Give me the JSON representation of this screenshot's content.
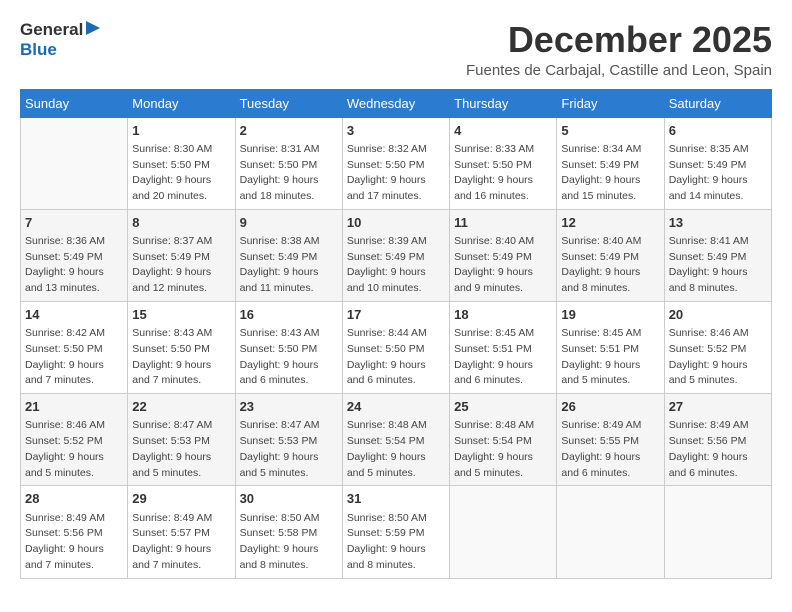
{
  "header": {
    "logo_general": "General",
    "logo_blue": "Blue",
    "month": "December 2025",
    "location": "Fuentes de Carbajal, Castille and Leon, Spain"
  },
  "columns": [
    "Sunday",
    "Monday",
    "Tuesday",
    "Wednesday",
    "Thursday",
    "Friday",
    "Saturday"
  ],
  "weeks": [
    [
      {
        "day": "",
        "info": ""
      },
      {
        "day": "1",
        "info": "Sunrise: 8:30 AM\nSunset: 5:50 PM\nDaylight: 9 hours\nand 20 minutes."
      },
      {
        "day": "2",
        "info": "Sunrise: 8:31 AM\nSunset: 5:50 PM\nDaylight: 9 hours\nand 18 minutes."
      },
      {
        "day": "3",
        "info": "Sunrise: 8:32 AM\nSunset: 5:50 PM\nDaylight: 9 hours\nand 17 minutes."
      },
      {
        "day": "4",
        "info": "Sunrise: 8:33 AM\nSunset: 5:50 PM\nDaylight: 9 hours\nand 16 minutes."
      },
      {
        "day": "5",
        "info": "Sunrise: 8:34 AM\nSunset: 5:49 PM\nDaylight: 9 hours\nand 15 minutes."
      },
      {
        "day": "6",
        "info": "Sunrise: 8:35 AM\nSunset: 5:49 PM\nDaylight: 9 hours\nand 14 minutes."
      }
    ],
    [
      {
        "day": "7",
        "info": "Sunrise: 8:36 AM\nSunset: 5:49 PM\nDaylight: 9 hours\nand 13 minutes."
      },
      {
        "day": "8",
        "info": "Sunrise: 8:37 AM\nSunset: 5:49 PM\nDaylight: 9 hours\nand 12 minutes."
      },
      {
        "day": "9",
        "info": "Sunrise: 8:38 AM\nSunset: 5:49 PM\nDaylight: 9 hours\nand 11 minutes."
      },
      {
        "day": "10",
        "info": "Sunrise: 8:39 AM\nSunset: 5:49 PM\nDaylight: 9 hours\nand 10 minutes."
      },
      {
        "day": "11",
        "info": "Sunrise: 8:40 AM\nSunset: 5:49 PM\nDaylight: 9 hours\nand 9 minutes."
      },
      {
        "day": "12",
        "info": "Sunrise: 8:40 AM\nSunset: 5:49 PM\nDaylight: 9 hours\nand 8 minutes."
      },
      {
        "day": "13",
        "info": "Sunrise: 8:41 AM\nSunset: 5:49 PM\nDaylight: 9 hours\nand 8 minutes."
      }
    ],
    [
      {
        "day": "14",
        "info": "Sunrise: 8:42 AM\nSunset: 5:50 PM\nDaylight: 9 hours\nand 7 minutes."
      },
      {
        "day": "15",
        "info": "Sunrise: 8:43 AM\nSunset: 5:50 PM\nDaylight: 9 hours\nand 7 minutes."
      },
      {
        "day": "16",
        "info": "Sunrise: 8:43 AM\nSunset: 5:50 PM\nDaylight: 9 hours\nand 6 minutes."
      },
      {
        "day": "17",
        "info": "Sunrise: 8:44 AM\nSunset: 5:50 PM\nDaylight: 9 hours\nand 6 minutes."
      },
      {
        "day": "18",
        "info": "Sunrise: 8:45 AM\nSunset: 5:51 PM\nDaylight: 9 hours\nand 6 minutes."
      },
      {
        "day": "19",
        "info": "Sunrise: 8:45 AM\nSunset: 5:51 PM\nDaylight: 9 hours\nand 5 minutes."
      },
      {
        "day": "20",
        "info": "Sunrise: 8:46 AM\nSunset: 5:52 PM\nDaylight: 9 hours\nand 5 minutes."
      }
    ],
    [
      {
        "day": "21",
        "info": "Sunrise: 8:46 AM\nSunset: 5:52 PM\nDaylight: 9 hours\nand 5 minutes."
      },
      {
        "day": "22",
        "info": "Sunrise: 8:47 AM\nSunset: 5:53 PM\nDaylight: 9 hours\nand 5 minutes."
      },
      {
        "day": "23",
        "info": "Sunrise: 8:47 AM\nSunset: 5:53 PM\nDaylight: 9 hours\nand 5 minutes."
      },
      {
        "day": "24",
        "info": "Sunrise: 8:48 AM\nSunset: 5:54 PM\nDaylight: 9 hours\nand 5 minutes."
      },
      {
        "day": "25",
        "info": "Sunrise: 8:48 AM\nSunset: 5:54 PM\nDaylight: 9 hours\nand 5 minutes."
      },
      {
        "day": "26",
        "info": "Sunrise: 8:49 AM\nSunset: 5:55 PM\nDaylight: 9 hours\nand 6 minutes."
      },
      {
        "day": "27",
        "info": "Sunrise: 8:49 AM\nSunset: 5:56 PM\nDaylight: 9 hours\nand 6 minutes."
      }
    ],
    [
      {
        "day": "28",
        "info": "Sunrise: 8:49 AM\nSunset: 5:56 PM\nDaylight: 9 hours\nand 7 minutes."
      },
      {
        "day": "29",
        "info": "Sunrise: 8:49 AM\nSunset: 5:57 PM\nDaylight: 9 hours\nand 7 minutes."
      },
      {
        "day": "30",
        "info": "Sunrise: 8:50 AM\nSunset: 5:58 PM\nDaylight: 9 hours\nand 8 minutes."
      },
      {
        "day": "31",
        "info": "Sunrise: 8:50 AM\nSunset: 5:59 PM\nDaylight: 9 hours\nand 8 minutes."
      },
      {
        "day": "",
        "info": ""
      },
      {
        "day": "",
        "info": ""
      },
      {
        "day": "",
        "info": ""
      }
    ]
  ]
}
